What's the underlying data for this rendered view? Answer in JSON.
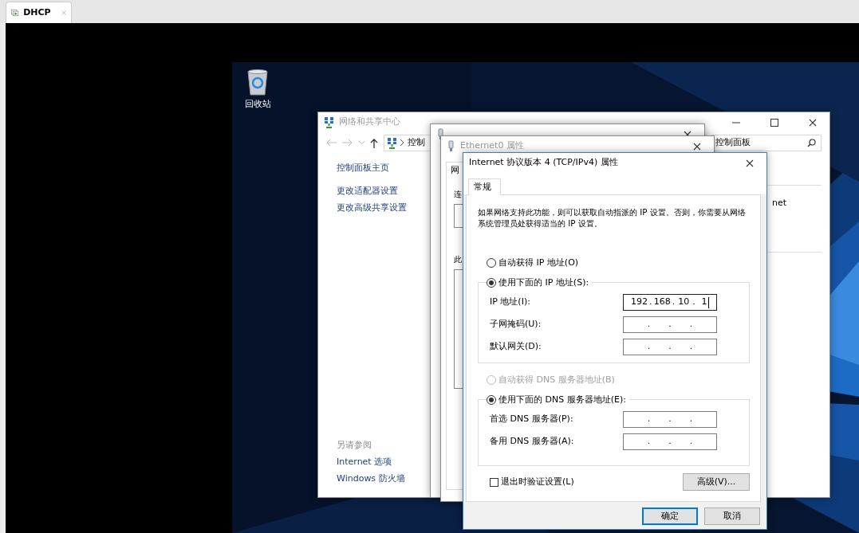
{
  "host_tabs": [
    {
      "label": "DHCP",
      "selected": true
    }
  ],
  "desktop": {
    "icons": [
      {
        "label": "回收站"
      }
    ]
  },
  "network_center": {
    "title": "网络和共享中心",
    "breadcrumb": "控制",
    "search": "控制面板",
    "sidebar_links": [
      "控制面板主页",
      "更改适配器设置",
      "更改高级共享设置"
    ],
    "see_also_heading": "另请参阅",
    "see_also_links": [
      "Internet 选项",
      "Windows 防火墙"
    ],
    "content_fragment": "net"
  },
  "properties_window": {
    "title": "Ethernet0 属性",
    "tabs": [
      {
        "label": "网",
        "selected": true
      }
    ],
    "connect_label": "连",
    "items_label": "此"
  },
  "tcp_dialog": {
    "title": "Internet 协议版本 4 (TCP/IPv4) 属性",
    "tabs": [
      {
        "label": "常规",
        "selected": true
      }
    ],
    "description": "如果网络支持此功能，则可以获取自动指派的 IP 设置。否则，你需要从网络系统管理员处获得适当的 IP 设置。",
    "ip_mode": [
      {
        "label": "自动获得 IP 地址(O)",
        "selected": false,
        "disabled": false
      },
      {
        "label": "使用下面的 IP 地址(S):",
        "selected": true,
        "disabled": false
      }
    ],
    "ip_fields": [
      {
        "label": "IP 地址(I):",
        "octets": [
          "192",
          "168",
          "10",
          "1"
        ],
        "separators": [
          ".",
          ".",
          "."
        ],
        "focused": true
      },
      {
        "label": "子网掩码(U):",
        "separators": [
          ".",
          ".",
          "."
        ],
        "focused": false
      },
      {
        "label": "默认网关(D):",
        "separators": [
          ".",
          ".",
          "."
        ],
        "focused": false
      }
    ],
    "dns_mode": [
      {
        "label": "自动获得 DNS 服务器地址(B)",
        "selected": false,
        "disabled": true
      },
      {
        "label": "使用下面的 DNS 服务器地址(E):",
        "selected": true,
        "disabled": false
      }
    ],
    "dns_fields": [
      {
        "label": "首选 DNS 服务器(P):",
        "separators": [
          ".",
          ".",
          "."
        ],
        "focused": false
      },
      {
        "label": "备用 DNS 服务器(A):",
        "separators": [
          ".",
          ".",
          "."
        ],
        "focused": false
      }
    ],
    "validate_on_exit": {
      "label": "退出时验证设置(L)",
      "checked": false
    },
    "advanced_button": "高级(V)...",
    "buttons": [
      {
        "label": "确定",
        "default": true
      },
      {
        "label": "取消",
        "default": false
      }
    ]
  }
}
